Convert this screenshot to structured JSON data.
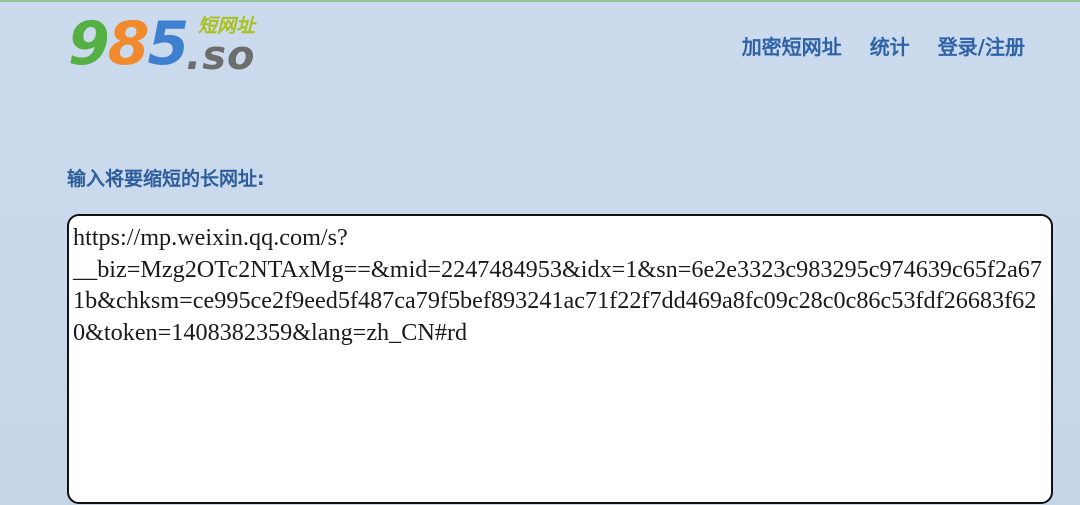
{
  "logo": {
    "digit_1": "9",
    "digit_2": "8",
    "digit_3": "5",
    "suffix": ".so",
    "tagline": "短网址",
    "colors": {
      "digit_1": "#55b043",
      "digit_2": "#f08a2d",
      "digit_3": "#3f7fcf",
      "suffix": "#6d6d6d",
      "tagline": "#a8c11d"
    }
  },
  "nav": {
    "items": [
      {
        "label": "加密短网址"
      },
      {
        "label": "统计"
      },
      {
        "label": "登录/注册"
      }
    ],
    "color": "#2f63a8"
  },
  "form": {
    "label": "输入将要缩短的长网址:",
    "url_value": "https://mp.weixin.qq.com/s?\n__biz=Mzg2OTc2NTAxMg==&mid=2247484953&idx=1&sn=6e2e3323c983295c974639c65f2a671b&chksm=ce995ce2f9eed5f487ca79f5bef893241ac71f22f7dd469a8fc09c28c0c86c53fdf26683f620&token=1408382359&lang=zh_CN#rd"
  }
}
